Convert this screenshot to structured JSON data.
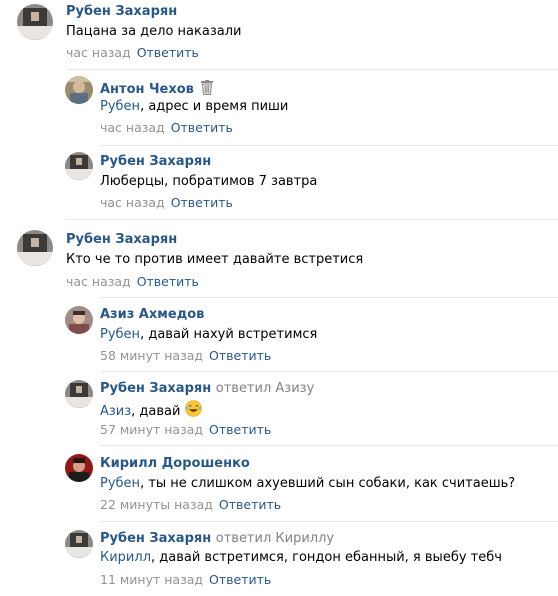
{
  "comments": [
    {
      "author": "Рубен Захарян",
      "text": "Пацана за дело наказали",
      "time": "час назад",
      "reply_label": "Ответить"
    },
    {
      "author": "Антон Чехов",
      "author_icon": "trash-icon",
      "mention": "Рубен",
      "text": ", адрес и время пиши",
      "time": "час назад",
      "reply_label": "Ответить"
    },
    {
      "author": "Рубен Захарян",
      "text": "Люберцы, побратимов 7 завтра",
      "time": "час назад",
      "reply_label": "Ответить"
    },
    {
      "author": "Рубен Захарян",
      "text": "Кто че то против имеет давайте встретися",
      "time": "час назад",
      "reply_label": "Ответить"
    },
    {
      "author": "Азиз Ахмедов",
      "mention": "Рубен",
      "text": ", давай нахуй встретимся",
      "time": "58 минут назад",
      "reply_label": "Ответить"
    },
    {
      "author": "Рубен Захарян",
      "replied_to": "ответил Азизу",
      "mention": "Азиз",
      "text": ", давай",
      "emoji": "laughing-crying-emoji",
      "time": "57 минут назад",
      "reply_label": "Ответить"
    },
    {
      "author": "Кирилл Дорошенко",
      "mention": "Рубен",
      "text": ", ты не слишком ахуевший сын собаки, как считаешь?",
      "time": "22 минуты назад",
      "reply_label": "Ответить"
    },
    {
      "author": "Рубен Захарян",
      "replied_to": "ответил Кириллу",
      "mention": "Кирилл",
      "text": ", давай встретимся, гондон ебанный, я выебу тебч",
      "time": "11 минут назад",
      "reply_label": "Ответить"
    }
  ],
  "colors": {
    "link": "#2a5885",
    "meta": "#939393",
    "separator": "#e7e8ec"
  }
}
